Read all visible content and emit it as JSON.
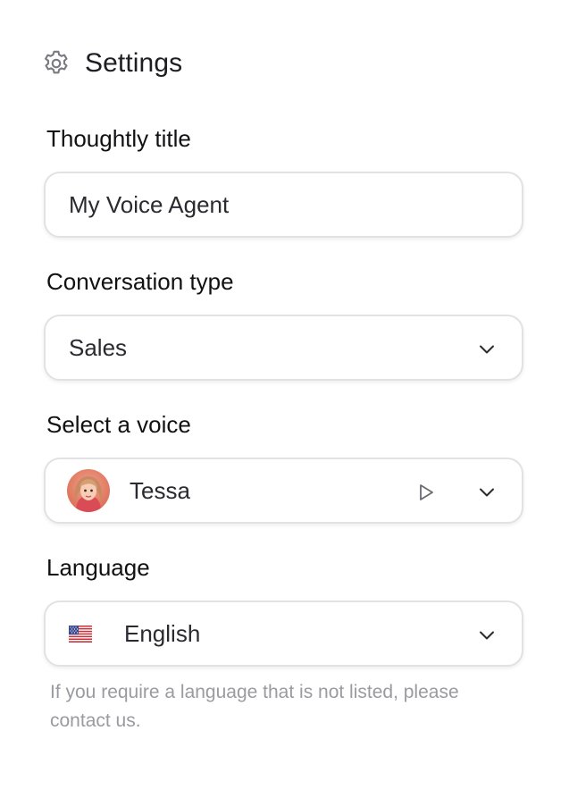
{
  "header": {
    "icon": "gear-icon",
    "title": "Settings"
  },
  "fields": {
    "title": {
      "label": "Thoughtly title",
      "value": "My Voice Agent"
    },
    "conversation_type": {
      "label": "Conversation type",
      "selected": "Sales"
    },
    "voice": {
      "label": "Select a voice",
      "selected": "Tessa",
      "avatar_icon": "avatar-icon",
      "play_icon": "play-icon"
    },
    "language": {
      "label": "Language",
      "selected": "English",
      "flag_icon": "us-flag-icon",
      "hint": "If you require a language that is not listed, please contact us."
    }
  },
  "colors": {
    "border": "#e2e2e4",
    "text": "#1f1f23",
    "muted": "#9a9aa0",
    "icon": "#6b6b73"
  }
}
